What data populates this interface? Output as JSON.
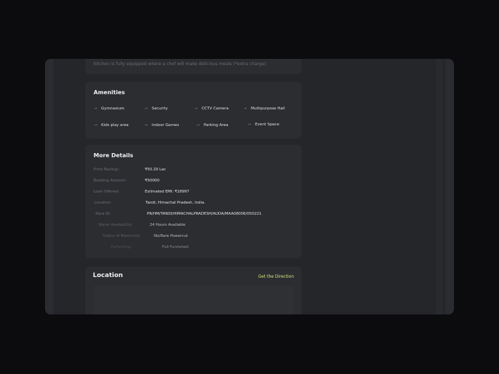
{
  "top_text": "Kitchen is fully equipped where a chef will make delicious meals (*extra charge).",
  "amenities": {
    "title": "Amenities",
    "items": [
      {
        "label": "Gymnasium"
      },
      {
        "label": "Security"
      },
      {
        "label": "CCTV Camera"
      },
      {
        "label": "Multipurpose Hall"
      },
      {
        "label": "Kids play area"
      },
      {
        "label": "Indoor Games"
      },
      {
        "label": "Parking Area"
      },
      {
        "label": "Event Space"
      }
    ]
  },
  "more_details": {
    "title": "More Details",
    "rows": [
      {
        "label": "Price Backup:",
        "value": "₹50.20 Lac"
      },
      {
        "label": "Booking Amount:",
        "value": "₹50000"
      },
      {
        "label": "Loan Offered:",
        "value": "Estimated EMI: ₹18997"
      },
      {
        "label": "Location:",
        "value": "Tandi, Himachal Pradesh, India."
      },
      {
        "label": "Rera ID:",
        "value": "PR/HM/TANDI/HIMACHALPRADESH/AUDA/MAA08006/050221"
      },
      {
        "label": "Water Availability:",
        "value": "24 Hours Available"
      },
      {
        "label": "Status of Electricity:",
        "value": "No/Rare Powercut"
      },
      {
        "label": "Furnishing:",
        "value": "Full Furnished"
      }
    ]
  },
  "location": {
    "title": "Location",
    "link": "Get the Direction"
  },
  "colors": {
    "page_bg": "#0c0c0e",
    "panel_bg": "#24262a",
    "card_bg": "#2b2d31",
    "accent_link": "#d8ec7a"
  }
}
